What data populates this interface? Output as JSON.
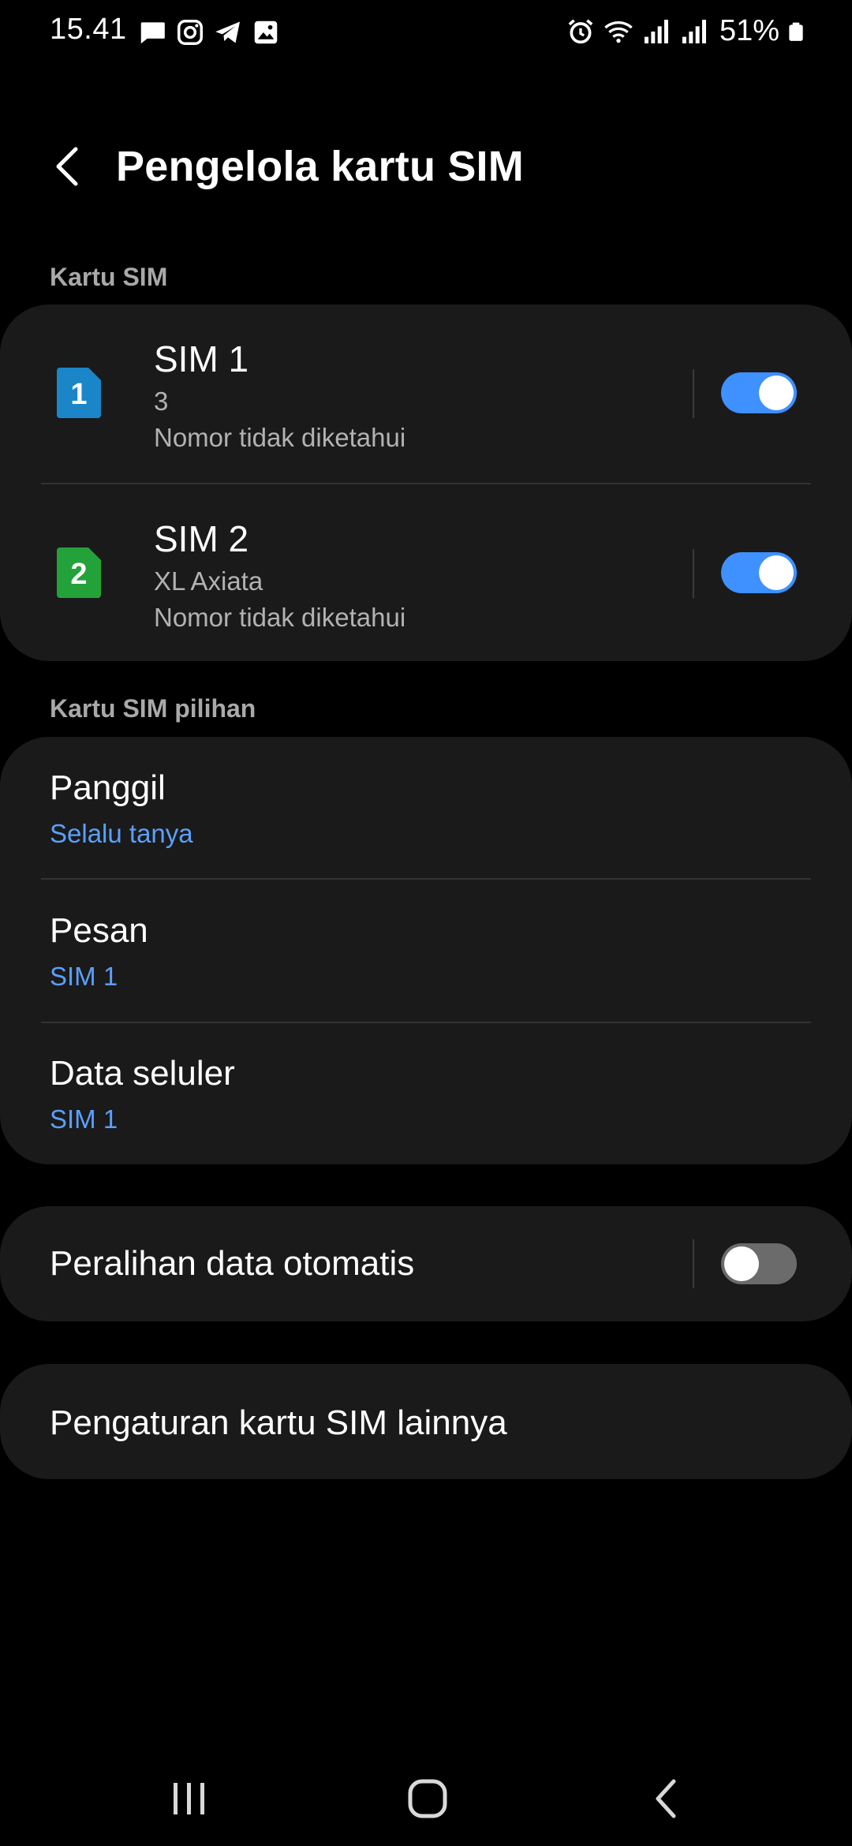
{
  "status_bar": {
    "time": "15.41",
    "battery_percent": "51%",
    "left_icons": [
      "chat-bubble-icon",
      "instagram-icon",
      "telegram-icon",
      "gallery-icon"
    ],
    "right_icons": [
      "alarm-icon",
      "wifi-icon",
      "signal-sim1-icon",
      "signal-sim2-icon",
      "battery-icon"
    ]
  },
  "header": {
    "title": "Pengelola kartu SIM"
  },
  "sim_section": {
    "label": "Kartu SIM",
    "cards": [
      {
        "badge": "1",
        "badge_color": "#1a86c8",
        "name": "SIM 1",
        "carrier": "3",
        "number": "Nomor tidak diketahui",
        "enabled": true
      },
      {
        "badge": "2",
        "badge_color": "#23a23a",
        "name": "SIM 2",
        "carrier": "XL Axiata",
        "number": "Nomor tidak diketahui",
        "enabled": true
      }
    ]
  },
  "preferred_section": {
    "label": "Kartu SIM pilihan",
    "items": [
      {
        "title": "Panggil",
        "value": "Selalu tanya"
      },
      {
        "title": "Pesan",
        "value": "SIM 1"
      },
      {
        "title": "Data seluler",
        "value": "SIM 1"
      }
    ]
  },
  "auto_data_switch": {
    "title": "Peralihan data otomatis",
    "enabled": false
  },
  "more_settings": {
    "title": "Pengaturan kartu SIM lainnya"
  },
  "colors": {
    "accent": "#3e91ff",
    "link": "#5aa0ff",
    "card_bg": "#1a1a1a",
    "background": "#000000"
  },
  "nav_bar": {
    "buttons": [
      "recent-apps-icon",
      "home-icon",
      "back-icon"
    ]
  }
}
